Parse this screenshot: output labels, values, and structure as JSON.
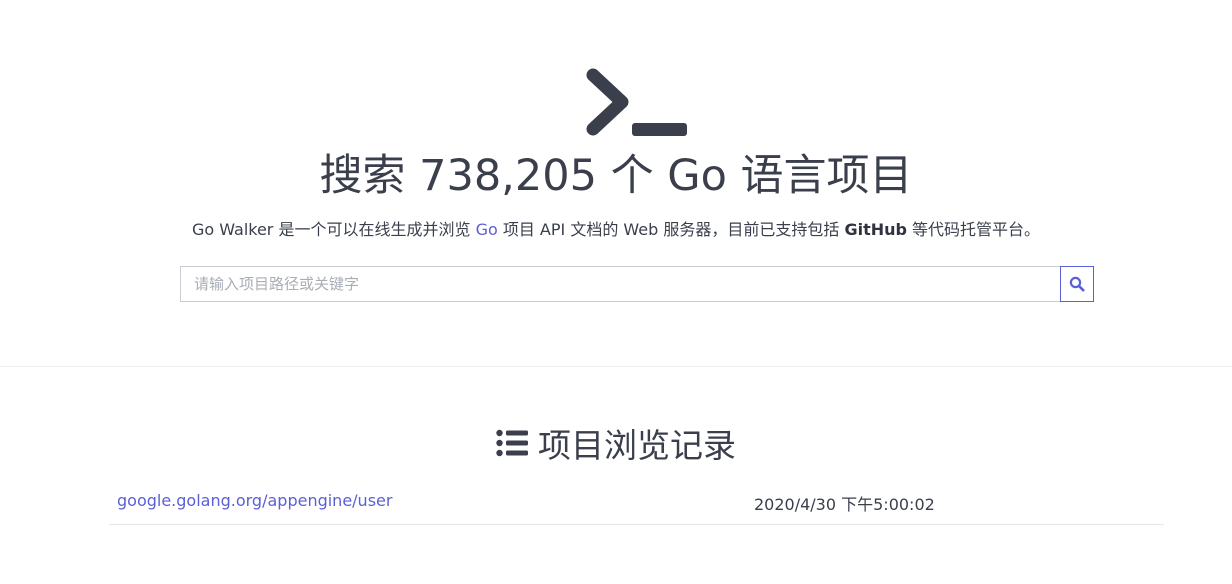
{
  "hero": {
    "icon": "terminal-prompt-icon",
    "title": "搜索 738,205 个 Go 语言项目",
    "tagline": {
      "part1": "Go Walker 是一个可以在线生成并浏览 ",
      "go_link": "Go",
      "part2": " 项目 API 文档的 Web 服务器，目前已支持包括 ",
      "github": "GitHub",
      "part3": " 等代码托管平台。"
    }
  },
  "search": {
    "placeholder": "请输入项目路径或关键字",
    "value": "",
    "button_icon": "search-icon"
  },
  "history": {
    "icon": "list-icon",
    "title": "项目浏览记录",
    "rows": [
      {
        "project": "google.golang.org/appengine/user",
        "time": "2020/4/30 下午5:00:02"
      }
    ]
  },
  "colors": {
    "accent": "#5b5fd6",
    "text": "#3a3f4b",
    "divider": "#e4e6ea"
  }
}
